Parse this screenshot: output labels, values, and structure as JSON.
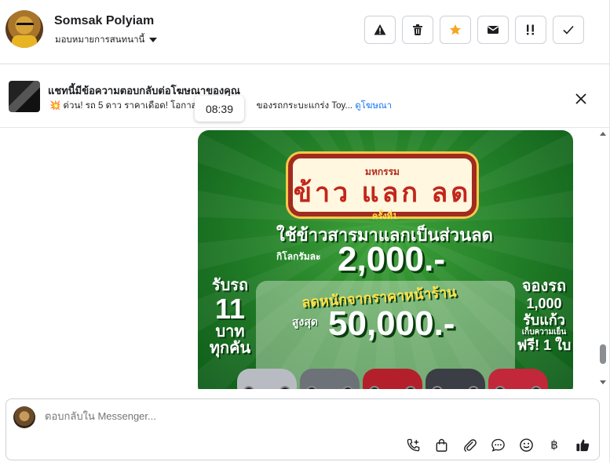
{
  "header": {
    "name": "Somsak Polyiam",
    "assign_label": "มอบหมายการสนทนานี้",
    "actions": [
      {
        "name": "report-button",
        "icon": "warning-icon"
      },
      {
        "name": "delete-button",
        "icon": "trash-icon"
      },
      {
        "name": "star-button",
        "icon": "star-icon",
        "color": "#f5a623"
      },
      {
        "name": "mark-unread-button",
        "icon": "envelope-icon"
      },
      {
        "name": "follow-up-button",
        "icon": "follow-up-icon"
      },
      {
        "name": "mark-done-button",
        "icon": "check-icon"
      }
    ]
  },
  "ad": {
    "title": "แชทนี้มีข้อความตอบกลับต่อโฆษณาของคุณ",
    "emoji": "💥",
    "subtitle": "ด่วน! รถ 5 ดาว ราคาเดือด! โอกาสที่",
    "subtitle_tail": "ของรถกระบะแกร่ง Toy...",
    "link": "ดูโฆษณา",
    "tooltip_time": "08:39"
  },
  "promo": {
    "sign_small": "มหกรรม",
    "sign_big": "ข้าว แลก ลด",
    "round": "ครั้งที่1",
    "line1": "ใช้ข้าวสารมาแลกเป็นส่วนลด",
    "per_kg": "กิโลกรัมละ",
    "amount1": "2,000.-",
    "line2": "ลดหนักจากราคาหน้าร้าน",
    "max_label": "สูงสุด",
    "amount2": "50,000.-",
    "left_a": "รับรถ",
    "left_b": "11",
    "left_c": "บาท",
    "left_d": "ทุกคัน",
    "right_a": "จองรถ",
    "right_b": "1,000",
    "right_c": "รับแก้ว",
    "right_d": "เก็บความเย็น",
    "right_e": "ฟรี! 1 ใบ"
  },
  "composer": {
    "placeholder": "ตอบกลับใน Messenger...",
    "tools": [
      "call-icon",
      "shopping-bag-icon",
      "attachment-icon",
      "chat-bubble-icon",
      "emoji-icon",
      "baht-icon",
      "thumbs-up-icon"
    ],
    "baht_symbol": "฿"
  }
}
